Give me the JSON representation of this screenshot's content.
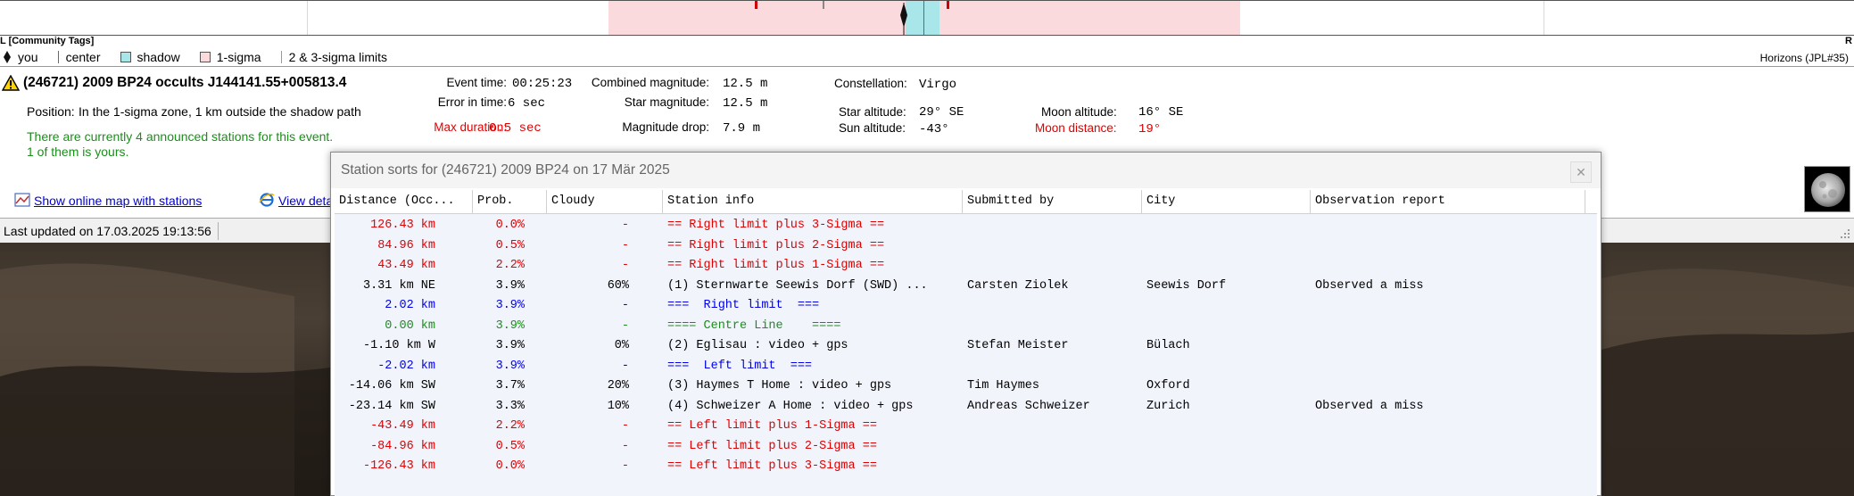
{
  "strip": {
    "left_label": "L [Community Tags]",
    "right_label": "R"
  },
  "legend": {
    "you": "you",
    "center": "center",
    "shadow": "shadow",
    "one_sigma": "1-sigma",
    "limits": "2 & 3-sigma limits",
    "ephemeris": "Horizons (JPL#35)"
  },
  "event": {
    "title": "(246721) 2009 BP24 occults J144141.55+005813.4",
    "position_label": "Position:",
    "position_value": "In the 1-sigma zone, 1 km outside the shadow path",
    "stations_line1": "There are currently 4 announced stations for this event.",
    "stations_line2": "1 of them is yours.",
    "event_time_label": "Event time:",
    "event_time_value": "00:25:23",
    "error_time_label": "Error in time:",
    "error_time_value": "6 sec",
    "max_duration_label": "Max duration:",
    "max_duration_value": "0.5 sec",
    "combined_mag_label": "Combined magnitude:",
    "combined_mag_value": "12.5 m",
    "star_mag_label": "Star magnitude:",
    "star_mag_value": "12.5 m",
    "mag_drop_label": "Magnitude drop:",
    "mag_drop_value": "7.9 m",
    "constellation_label": "Constellation:",
    "constellation_value": "Virgo",
    "star_alt_label": "Star altitude:",
    "star_alt_value": "29° SE",
    "sun_alt_label": "Sun altitude:",
    "sun_alt_value": "-43°",
    "moon_alt_label": "Moon altitude:",
    "moon_alt_value": "16° SE",
    "moon_dist_label": "Moon distance:",
    "moon_dist_value": "19°"
  },
  "links": {
    "map": "Show online map with stations",
    "details": "View deta"
  },
  "status": {
    "last_updated": "Last updated on 17.03.2025 19:13:56"
  },
  "dialog": {
    "title": "Station sorts for (246721) 2009 BP24 on 17 Mär 2025",
    "close": "✕",
    "columns": [
      "Distance (Occ...",
      "Prob.",
      "Cloudy",
      "Station info",
      "Submitted by",
      "City",
      "Observation report"
    ],
    "rows": [
      {
        "dist": "126.43 km",
        "prob": "0.0%",
        "cloudy": "-",
        "info": "== Right limit plus 3-Sigma ==",
        "by": "",
        "city": "",
        "report": "",
        "color": "red"
      },
      {
        "dist": "84.96 km",
        "prob": "0.5%",
        "cloudy": "-",
        "info": "== Right limit plus 2-Sigma ==",
        "by": "",
        "city": "",
        "report": "",
        "color": "red"
      },
      {
        "dist": "43.49 km",
        "prob": "2.2%",
        "cloudy": "-",
        "info": "== Right limit plus 1-Sigma ==",
        "by": "",
        "city": "",
        "report": "",
        "color": "red"
      },
      {
        "dist": "3.31 km NE",
        "prob": "3.9%",
        "cloudy": "60%",
        "info": "(1) Sternwarte Seewis Dorf (SWD) ...",
        "by": "Carsten Ziolek",
        "city": "Seewis Dorf",
        "report": "Observed a miss",
        "color": "black"
      },
      {
        "dist": "2.02 km",
        "prob": "3.9%",
        "cloudy": "-",
        "info": "===  Right limit  ===",
        "by": "",
        "city": "",
        "report": "",
        "color": "blue"
      },
      {
        "dist": "0.00 km",
        "prob": "3.9%",
        "cloudy": "-",
        "info": "==== Centre Line    ====",
        "by": "",
        "city": "",
        "report": "",
        "color": "green"
      },
      {
        "dist": "-1.10 km W",
        "prob": "3.9%",
        "cloudy": "0%",
        "info": "(2) Eglisau : video + gps",
        "by": "Stefan Meister",
        "city": "Bülach",
        "report": "",
        "color": "black"
      },
      {
        "dist": "-2.02 km",
        "prob": "3.9%",
        "cloudy": "-",
        "info": "===  Left limit  ===",
        "by": "",
        "city": "",
        "report": "",
        "color": "blue"
      },
      {
        "dist": "-14.06 km SW",
        "prob": "3.7%",
        "cloudy": "20%",
        "info": "(3) Haymes T Home : video + gps",
        "by": "Tim Haymes",
        "city": "Oxford",
        "report": "",
        "color": "black"
      },
      {
        "dist": "-23.14 km SW",
        "prob": "3.3%",
        "cloudy": "10%",
        "info": "(4) Schweizer A Home : video + gps",
        "by": "Andreas Schweizer",
        "city": "Zurich",
        "report": "Observed a miss",
        "color": "black"
      },
      {
        "dist": "-43.49 km",
        "prob": "2.2%",
        "cloudy": "-",
        "info": "== Left limit plus 1-Sigma ==",
        "by": "",
        "city": "",
        "report": "",
        "color": "red"
      },
      {
        "dist": "-84.96 km",
        "prob": "0.5%",
        "cloudy": "-",
        "info": "== Left limit plus 2-Sigma ==",
        "by": "",
        "city": "",
        "report": "",
        "color": "red"
      },
      {
        "dist": "-126.43 km",
        "prob": "0.0%",
        "cloudy": "-",
        "info": "== Left limit plus 3-Sigma ==",
        "by": "",
        "city": "",
        "report": "",
        "color": "red"
      }
    ]
  },
  "colors": {
    "sigma_band": "#fadadd",
    "shadow_band": "#a8e6ea",
    "limit_red": "#e00000",
    "limit_blue": "#0000ee",
    "center_green": "#1a8f1a"
  },
  "icons": {
    "warning": "warning-icon",
    "map": "map-icon",
    "browser": "browser-icon",
    "moon": "moon-icon",
    "grip": "resize-grip-icon"
  }
}
